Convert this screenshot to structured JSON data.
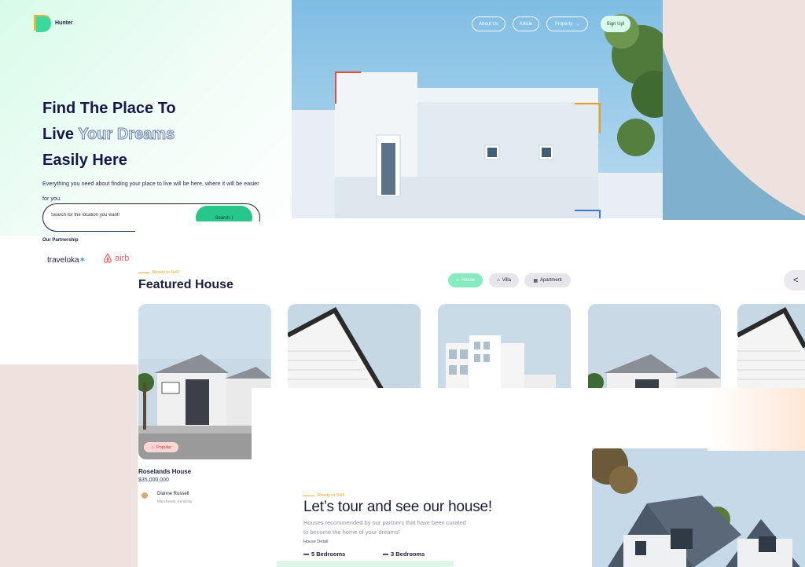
{
  "brand": {
    "name": "Hunter"
  },
  "nav": {
    "items": [
      "About Us",
      "Article",
      "Property"
    ],
    "property_chevron": "chevron-down-icon",
    "signup": "Sign Up!"
  },
  "hero": {
    "title_line1": "Find The Place To",
    "title_line2_a": "Live ",
    "title_line2_b": "Your Dreams",
    "title_line3": "Easily Here",
    "description": "Everything you need about finding your place to live will be here, where it will be easier for you.",
    "search_placeholder": "Search for the location you want!",
    "search_button": "Search ⟩",
    "partnership_title": "Our Partnership",
    "partners": [
      "traveloka",
      "airb"
    ]
  },
  "featured": {
    "eyebrow": "Ready to Sell!",
    "title": "Featured House",
    "tabs": [
      {
        "label": "House",
        "active": true
      },
      {
        "label": "Villa",
        "active": false
      },
      {
        "label": "Apartment",
        "active": false
      }
    ],
    "prev_arrow": "<",
    "card": {
      "badge": "Popular",
      "name": "Roselands House",
      "price": "$35,000,000",
      "agent_name": "Dianne Russell",
      "agent_location": "Manchester, Kentucky"
    }
  },
  "tour": {
    "eyebrow": "Ready to Sell!",
    "title": "Let’s tour and see our house!",
    "description": "Houses recommended by our partners that have been curated to become the home of your dreams!",
    "detail_label": "House Detail",
    "bedrooms_a": "5 Bedrooms",
    "bedrooms_b": "3 Bedrooms"
  },
  "colors": {
    "accent_green": "#27c78b",
    "navy": "#16184a",
    "eyebrow_orange": "#f5a623",
    "pink_bg": "#efe1dd",
    "blue_arc": "#7fb1cc"
  }
}
